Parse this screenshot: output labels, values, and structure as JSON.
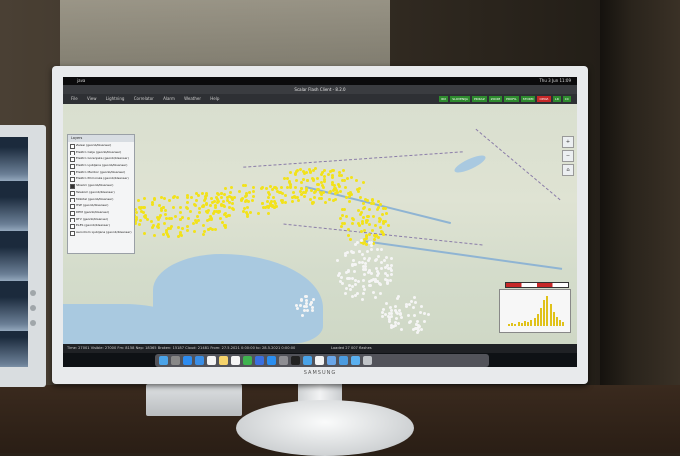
{
  "window": {
    "title": "Scalar Flash Client - 8.2.0",
    "menubar_app": "java",
    "clock": "Thu 3 Jun 11:09"
  },
  "app_menu": [
    "File",
    "View",
    "Lightning",
    "Correlator",
    "Alarm",
    "Weather",
    "Help"
  ],
  "status_buttons": [
    {
      "label": "IDX",
      "color": "#2e8b2e"
    },
    {
      "label": "SLOVENIJA",
      "color": "#2e8b2e"
    },
    {
      "label": "PRIKAZ",
      "color": "#2e8b2e"
    },
    {
      "label": "ZOOM",
      "color": "#2e8b2e"
    },
    {
      "label": "PROFIL",
      "color": "#2e8b2e"
    },
    {
      "label": "STORM",
      "color": "#2e8b2e"
    },
    {
      "label": "OPOZ.",
      "color": "#c62828"
    },
    {
      "label": "LR",
      "color": "#2e8b2e"
    },
    {
      "label": "CC",
      "color": "#2e8b2e"
    }
  ],
  "layers_panel": {
    "title": "Layers",
    "items": [
      {
        "label": "Zalesi (geonb/blsanser)",
        "checked": false
      },
      {
        "label": "Elektro Celje (geonb/blsanser)",
        "checked": false
      },
      {
        "label": "Elektro Gorenjska (geonb/blsanser)",
        "checked": false
      },
      {
        "label": "Elektro Ljubljana (geonb/blsanser)",
        "checked": false
      },
      {
        "label": "Elektro Maribor (geonb/blsanser)",
        "checked": false
      },
      {
        "label": "Elektro Primorska (geonb/blsanser)",
        "checked": false
      },
      {
        "label": "Strezici (geonb/blsanser)",
        "checked": true
      },
      {
        "label": "Telekom (geonb/blsanser)",
        "checked": false
      },
      {
        "label": "Mobitel (geonb/blsanser)",
        "checked": false
      },
      {
        "label": "HSE (geonb/blsanser)",
        "checked": false
      },
      {
        "label": "DEM (geonb/blsanser)",
        "checked": false
      },
      {
        "label": "RTV (geonb/blsanser)",
        "checked": false
      },
      {
        "label": "ELES (geonb/blsanser)",
        "checked": false
      },
      {
        "label": "Aerodrom Ljubljana (geonb/blsanser)",
        "checked": false
      }
    ]
  },
  "map_controls": [
    "+",
    "−",
    "⌂"
  ],
  "footer": {
    "stats": "Time: 27001  Visible: 27000  Fm: 8158  Nep: 18365  Broken: 15187  Cloud: 21481  From: 27.5.2021 0:00:00  to: 28.5.2021 0:00:00",
    "loaded": "Loaded 27 007 flashes"
  },
  "monitor": {
    "brand": "SAMSUNG"
  },
  "colors": {
    "strike_recent": "#f2e21a",
    "strike_old": "#f5f5f5",
    "sea": "#a9c9e0"
  },
  "dock_icons": [
    "finder-icon",
    "launchpad-icon",
    "safari-icon",
    "mail-icon",
    "calendar-icon",
    "notes-icon",
    "reminders-icon",
    "numbers-icon",
    "keynote-icon",
    "app-store-icon",
    "preferences-icon",
    "terminal-icon",
    "finder-2-icon",
    "textedit-icon",
    "preview-icon",
    "folder-icon",
    "downloads-icon",
    "trash-icon"
  ]
}
